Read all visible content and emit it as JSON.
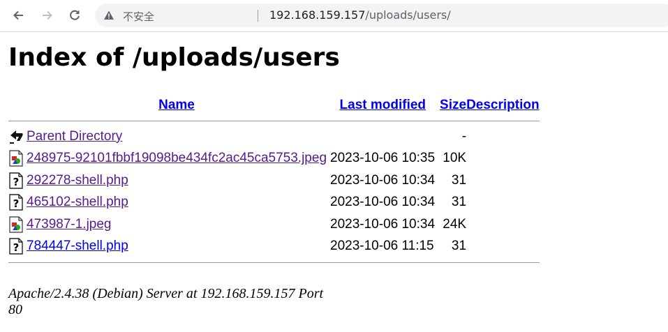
{
  "browser": {
    "security_label": "不安全",
    "url_host": "192.168.159.157",
    "url_path": "/uploads/users/"
  },
  "page": {
    "title": "Index of /uploads/users",
    "columns": {
      "name": "Name",
      "last_modified": "Last modified",
      "size": "Size",
      "description": "Description"
    },
    "parent": {
      "label": "Parent Directory",
      "size": "-",
      "icon": "back-icon"
    },
    "files": [
      {
        "name": "248975-92101fbbf19098be434fc2ac45ca5753.jpeg",
        "modified": "2023-10-06 10:35",
        "size": "10K",
        "icon": "image-icon",
        "visited": true
      },
      {
        "name": "292278-shell.php",
        "modified": "2023-10-06 10:34",
        "size": "31",
        "icon": "unknown-file-icon",
        "visited": true
      },
      {
        "name": "465102-shell.php",
        "modified": "2023-10-06 10:34",
        "size": "31",
        "icon": "unknown-file-icon",
        "visited": true
      },
      {
        "name": "473987-1.jpeg",
        "modified": "2023-10-06 10:34",
        "size": "24K",
        "icon": "image-icon",
        "visited": true
      },
      {
        "name": "784447-shell.php",
        "modified": "2023-10-06 11:15",
        "size": "31",
        "icon": "unknown-file-icon",
        "visited": false
      }
    ],
    "footer": "Apache/2.4.38 (Debian) Server at 192.168.159.157 Port 80"
  }
}
